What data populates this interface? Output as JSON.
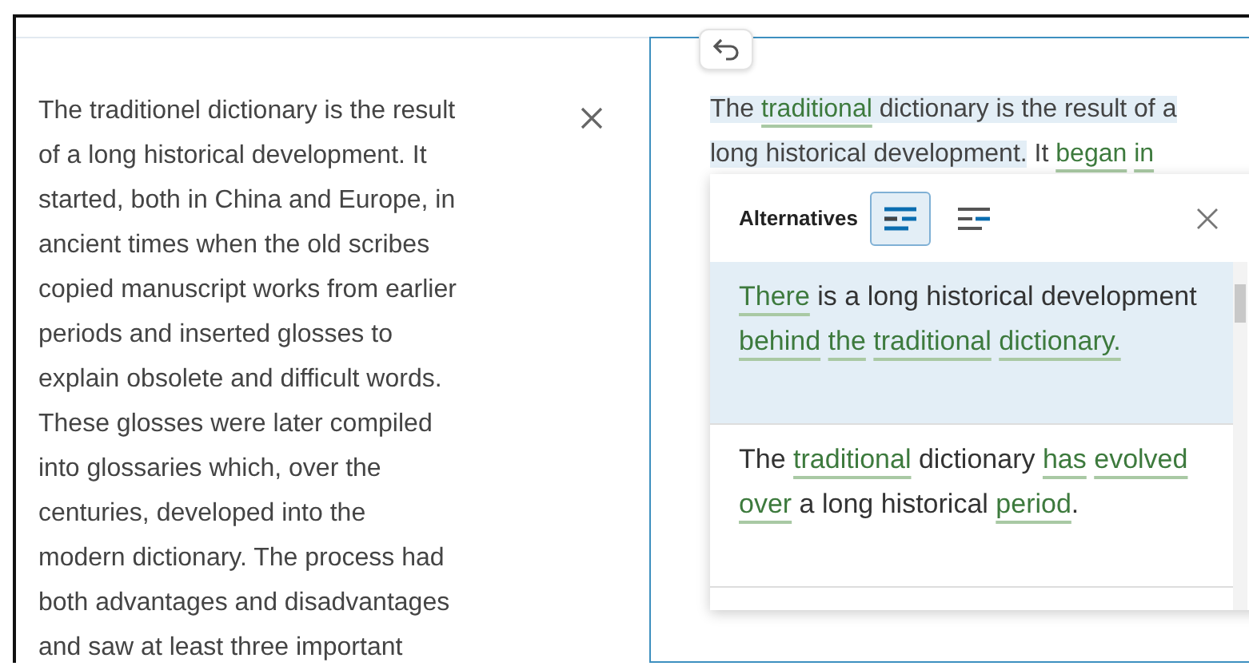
{
  "source_panel": {
    "lines": [
      "The traditionel dictionary is the result",
      "of a long historical development. It",
      "started, both in China and Europe, in",
      "ancient times when the old scribes",
      "copied manuscript works from earlier",
      "periods and inserted glosses to",
      "explain obsolete and difficult words.",
      "These glosses were later compiled",
      "into glossaries which, over the",
      "centuries, developed into the",
      "modern dictionary. The process had",
      "both advantages and disadvantages",
      "and saw at least three important"
    ]
  },
  "target_panel": {
    "lines": [
      [
        {
          "text": "The ",
          "changed": false,
          "selected": true
        },
        {
          "text": "traditional",
          "changed": true,
          "selected": true
        },
        {
          "text": " dictionary is the result of a",
          "changed": false,
          "selected": true
        }
      ],
      [
        {
          "text": "long historical development.",
          "changed": false,
          "selected": true
        },
        {
          "text": " It ",
          "changed": false,
          "selected": false
        },
        {
          "text": "began ",
          "changed": true,
          "selected": false
        },
        {
          "text": "in",
          "changed": true,
          "selected": false
        }
      ]
    ]
  },
  "alternatives": {
    "title": "Alternatives",
    "view_modes": [
      {
        "selected": true
      },
      {
        "selected": false
      }
    ],
    "items": [
      {
        "selected": true,
        "segments": [
          {
            "text": "There",
            "changed": true
          },
          {
            "text": " is a long historical development ",
            "changed": false
          },
          {
            "text": "behind ",
            "changed": true
          },
          {
            "text": "the ",
            "changed": true
          },
          {
            "text": "traditional ",
            "changed": true
          },
          {
            "text": "dictionary.",
            "changed": true
          }
        ]
      },
      {
        "selected": false,
        "segments": [
          {
            "text": "The ",
            "changed": false
          },
          {
            "text": "traditional",
            "changed": true
          },
          {
            "text": " dictionary ",
            "changed": false
          },
          {
            "text": "has ",
            "changed": true
          },
          {
            "text": "evolved ",
            "changed": true
          },
          {
            "text": "over",
            "changed": true
          },
          {
            "text": " a long historical ",
            "changed": false
          },
          {
            "text": "period",
            "changed": true
          },
          {
            "text": ".",
            "changed": false
          }
        ]
      }
    ]
  }
}
